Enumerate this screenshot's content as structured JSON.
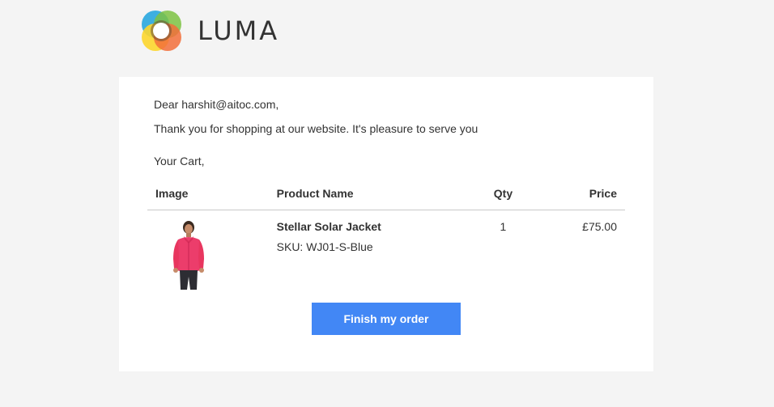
{
  "header": {
    "logo_text": "LUMA"
  },
  "email": {
    "greeting": "Dear harshit@aitoc.com,",
    "message": "Thank you for shopping at our website. It's pleasure to serve you",
    "cart_label": "Your Cart,"
  },
  "cart_table": {
    "headers": {
      "image": "Image",
      "product_name": "Product Name",
      "qty": "Qty",
      "price": "Price"
    },
    "rows": [
      {
        "name": "Stellar Solar Jacket",
        "sku": "SKU: WJ01-S-Blue",
        "qty": "1",
        "price": "£75.00"
      }
    ]
  },
  "actions": {
    "finish_label": "Finish my order"
  },
  "colors": {
    "button": "#4287f5",
    "page_background": "#f4f4f4",
    "card_background": "#ffffff"
  }
}
